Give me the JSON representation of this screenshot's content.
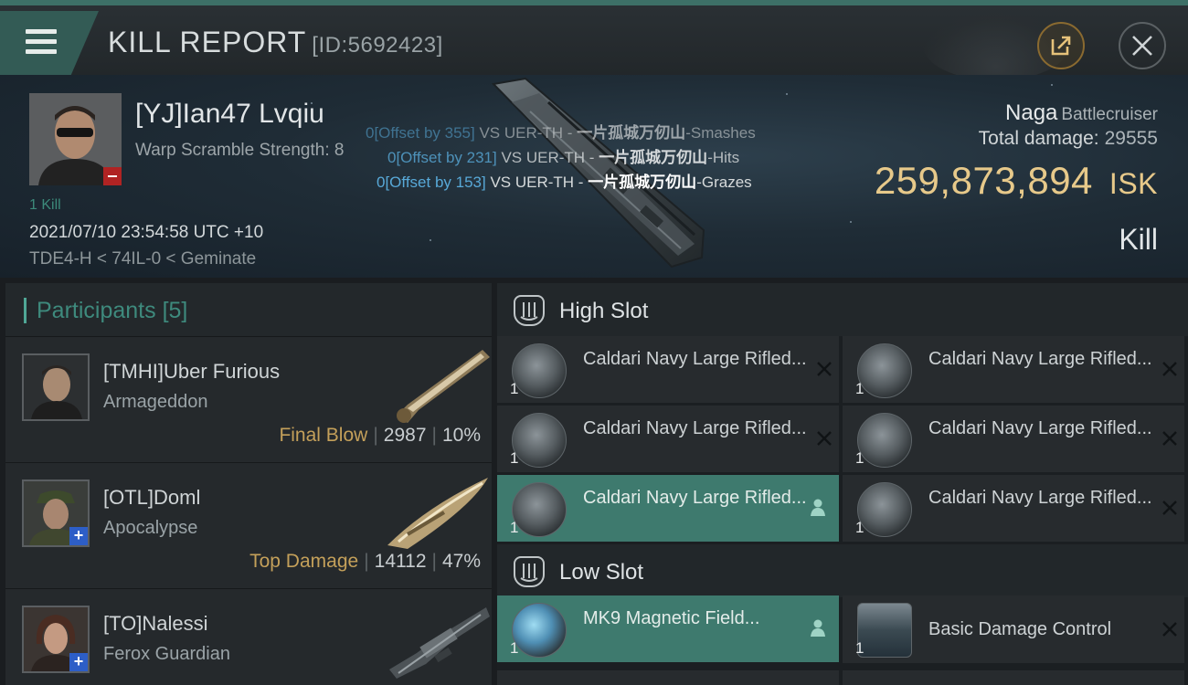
{
  "window": {
    "title": "KILL REPORT",
    "report_id": "[ID:5692423]"
  },
  "victim": {
    "name": "[YJ]Ian47 Lvqiu",
    "warp_scramble": "Warp Scramble Strength: 8",
    "kills": "1 Kill",
    "time": "2021/07/10 23:54:58 UTC +10",
    "location": "TDE4-H < 74IL-0 < Geminate",
    "ship_name": "Naga",
    "ship_class": "Battlecruiser",
    "total_damage_label": "Total damage:",
    "total_damage": "29555",
    "isk_value": "259,873,894",
    "isk_unit": "ISK",
    "result": "Kill"
  },
  "hits": [
    {
      "offset": "0[Offset by 355]",
      "vs": "VS UER-TH - ",
      "target": "一片孤城万仞山",
      "verb": "-Smashes"
    },
    {
      "offset": "0[Offset by 231]",
      "vs": "VS UER-TH - ",
      "target": "一片孤城万仞山",
      "verb": "-Hits"
    },
    {
      "offset": "0[Offset by 153]",
      "vs": "VS UER-TH - ",
      "target": "一片孤城万仞山",
      "verb": "-Grazes"
    }
  ],
  "participants": {
    "label": "Participants",
    "count": "[5]",
    "list": [
      {
        "name": "[TMHI]Uber Furious",
        "ship": "Armageddon",
        "tag": "Final Blow",
        "damage": "2987",
        "percent": "10%"
      },
      {
        "name": "[OTL]Doml",
        "ship": "Apocalypse",
        "tag": "Top Damage",
        "damage": "14112",
        "percent": "47%"
      },
      {
        "name": "[TO]Nalessi",
        "ship": "Ferox Guardian",
        "tag": "",
        "damage": "",
        "percent": ""
      }
    ]
  },
  "fitting": {
    "high_slot": {
      "label": "High Slot",
      "modules": [
        {
          "name": "Caldari Navy Large Rifled...",
          "qty": "1"
        },
        {
          "name": "Caldari Navy Large Rifled...",
          "qty": "1"
        },
        {
          "name": "Caldari Navy Large Rifled...",
          "qty": "1"
        },
        {
          "name": "Caldari Navy Large Rifled...",
          "qty": "1"
        },
        {
          "name": "Caldari Navy Large Rifled...",
          "qty": "1"
        },
        {
          "name": "Caldari Navy Large Rifled...",
          "qty": "1"
        }
      ]
    },
    "low_slot": {
      "label": "Low Slot",
      "modules": [
        {
          "name": "MK9 Magnetic Field...",
          "qty": "1"
        },
        {
          "name": "Basic Damage Control",
          "qty": "1"
        }
      ]
    }
  },
  "colors": {
    "accent_teal": "#3e7a6e",
    "isk_gold": "#e7c98a",
    "offset_blue": "#58a9d8",
    "tag_gold": "#c4a05a"
  }
}
